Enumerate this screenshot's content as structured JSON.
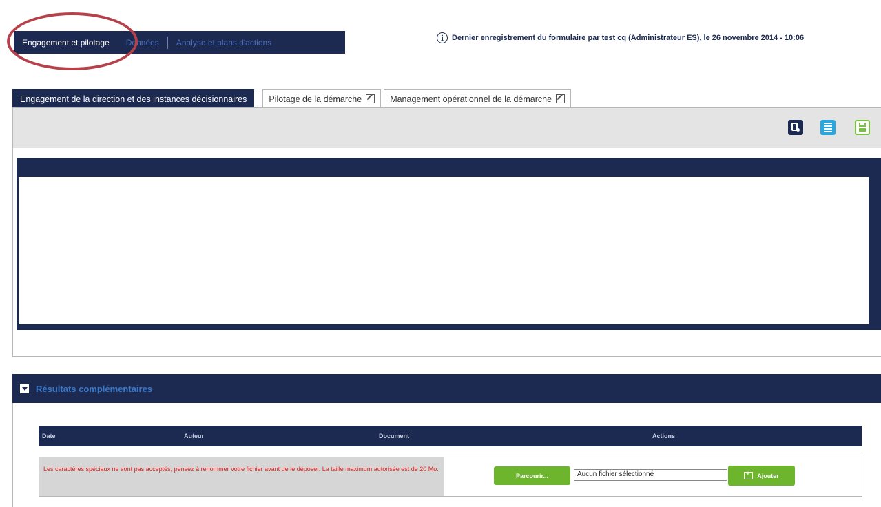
{
  "nav": {
    "tabs": [
      {
        "label": "Engagement et pilotage",
        "active": true
      },
      {
        "label": "Données",
        "active": false
      },
      {
        "label": "Analyse et plans d'actions",
        "active": false
      }
    ]
  },
  "save_info": {
    "icon": "info-icon",
    "text": "Dernier enregistrement du formulaire par test cq (Administrateur ES), le 26 novembre 2014 - 10:06"
  },
  "subtabs": [
    {
      "label": "Engagement de la direction et des instances décisionnaires",
      "active": true
    },
    {
      "label": "Pilotage de la démarche",
      "icon": "edit-icon"
    },
    {
      "label": "Management opérationnel de la démarche",
      "icon": "edit-icon"
    }
  ],
  "toolbar": {
    "icons": [
      "preview-icon",
      "list-icon",
      "save-icon"
    ]
  },
  "editor": {
    "value": ""
  },
  "results": {
    "title": "Résultats complémentaires",
    "columns": [
      "Date",
      "Auteur",
      "Document",
      "Actions"
    ],
    "upload": {
      "warning": "Les caractères spéciaux ne sont pas acceptés, pensez à renommer votre fichier avant de le déposer. La taille maximum autorisée est de 20 Mo.",
      "browse_label": "Parcourir...",
      "file_value": "Aucun fichier sélectionné",
      "add_label": "Ajouter"
    }
  },
  "colors": {
    "navy": "#1c2a52",
    "accent_blue": "#3a78c8",
    "green": "#6cb52d",
    "warning_red": "#e02020",
    "highlight": "#b5424a"
  }
}
